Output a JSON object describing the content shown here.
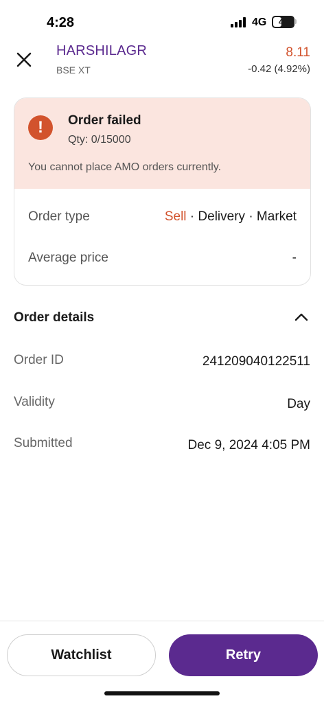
{
  "status_bar": {
    "time": "4:28",
    "network": "4G",
    "battery": "47",
    "battery_level_percent": 47
  },
  "header": {
    "symbol": "HARSHILAGR",
    "exchange": "BSE XT",
    "price": "8.11",
    "change": "-0.42 (4.92%)",
    "close_icon": "close-icon"
  },
  "order_status": {
    "title": "Order failed",
    "qty": "Qty: 0/15000",
    "message": "You cannot place AMO orders currently.",
    "icon": "exclamation-icon"
  },
  "order_summary": {
    "order_type_label": "Order type",
    "side": "Sell",
    "product": "Delivery",
    "order_kind": "Market",
    "separator": "·",
    "avg_price_label": "Average price",
    "avg_price_value": "-"
  },
  "order_details": {
    "title": "Order details",
    "expanded": true,
    "rows": [
      {
        "label": "Order ID",
        "value": "241209040122511"
      },
      {
        "label": "Validity",
        "value": "Day"
      },
      {
        "label": "Submitted",
        "value": "Dec 9, 2024 4:05 PM"
      }
    ]
  },
  "actions": {
    "watchlist_label": "Watchlist",
    "retry_label": "Retry"
  },
  "colors": {
    "brand": "#5b2a8f",
    "negative": "#d2532d",
    "alert_bg": "#fbe5df"
  }
}
